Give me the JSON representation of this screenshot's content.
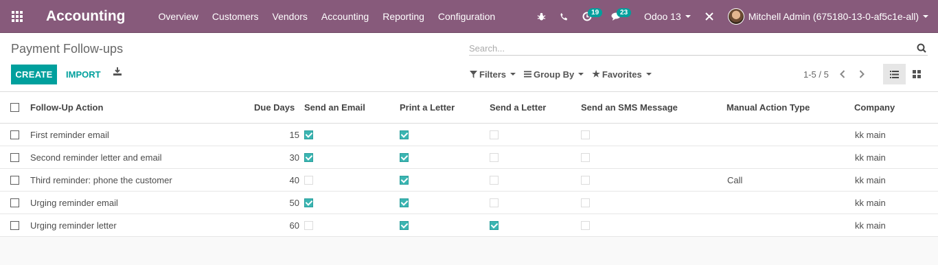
{
  "navbar": {
    "app_title": "Accounting",
    "menu": [
      "Overview",
      "Customers",
      "Vendors",
      "Accounting",
      "Reporting",
      "Configuration"
    ],
    "activity_count": "19",
    "messages_count": "23",
    "database": "Odoo 13",
    "user": "Mitchell Admin (675180-13-0-af5c1e-all)"
  },
  "control": {
    "breadcrumb": "Payment Follow-ups",
    "search_placeholder": "Search...",
    "create_label": "CREATE",
    "import_label": "IMPORT",
    "filters_label": "Filters",
    "groupby_label": "Group By",
    "favorites_label": "Favorites",
    "pager": "1-5 / 5"
  },
  "table": {
    "columns": [
      "Follow-Up Action",
      "Due Days",
      "Send an Email",
      "Print a Letter",
      "Send a Letter",
      "Send an SMS Message",
      "Manual Action Type",
      "Company"
    ],
    "rows": [
      {
        "action": "First reminder email",
        "due": "15",
        "email": true,
        "print": true,
        "letter": false,
        "sms": false,
        "manual": "",
        "company": "kk main"
      },
      {
        "action": "Second reminder letter and email",
        "due": "30",
        "email": true,
        "print": true,
        "letter": false,
        "sms": false,
        "manual": "",
        "company": "kk main"
      },
      {
        "action": "Third reminder: phone the customer",
        "due": "40",
        "email": false,
        "print": true,
        "letter": false,
        "sms": false,
        "manual": "Call",
        "company": "kk main"
      },
      {
        "action": "Urging reminder email",
        "due": "50",
        "email": true,
        "print": true,
        "letter": false,
        "sms": false,
        "manual": "",
        "company": "kk main"
      },
      {
        "action": "Urging reminder letter",
        "due": "60",
        "email": false,
        "print": true,
        "letter": true,
        "sms": false,
        "manual": "",
        "company": "kk main"
      }
    ]
  },
  "colors": {
    "navbar": "#875a7b",
    "primary": "#00a09d"
  }
}
